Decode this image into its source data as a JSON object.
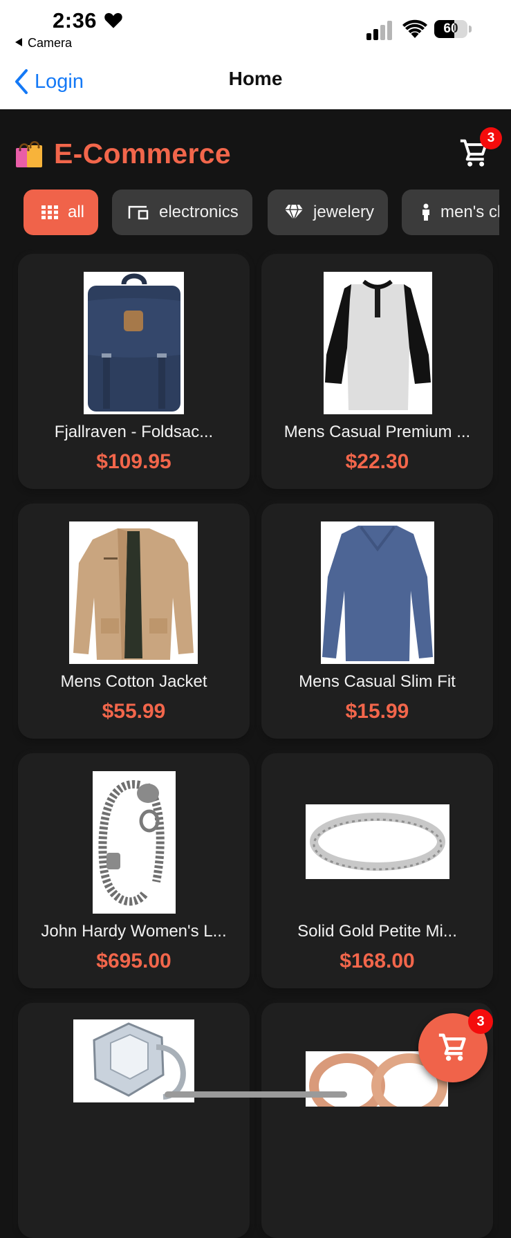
{
  "status_bar": {
    "time": "2:36",
    "back_app": "Camera",
    "battery": "60",
    "battery_level": 0.6
  },
  "nav": {
    "back_label": "Login",
    "title": "Home"
  },
  "app": {
    "brand": "E-Commerce",
    "cart_count": "3",
    "fab_cart_count": "3",
    "accent": "#f2664b"
  },
  "categories": [
    {
      "label": "all",
      "icon": "grid-icon",
      "active": true
    },
    {
      "label": "electronics",
      "icon": "laptop-icon",
      "active": false
    },
    {
      "label": "jewelery",
      "icon": "diamond-icon",
      "active": false
    },
    {
      "label": "men's clothing",
      "icon": "person-icon",
      "active": false
    }
  ],
  "products": [
    {
      "title": "Fjallraven - Foldsac...",
      "price": "$109.95"
    },
    {
      "title": "Mens Casual Premium ...",
      "price": "$22.30"
    },
    {
      "title": "Mens Cotton Jacket",
      "price": "$55.99"
    },
    {
      "title": "Mens Casual Slim Fit",
      "price": "$15.99"
    },
    {
      "title": "John Hardy Women's L...",
      "price": "$695.00"
    },
    {
      "title": "Solid Gold Petite Mi...",
      "price": "$168.00"
    }
  ]
}
